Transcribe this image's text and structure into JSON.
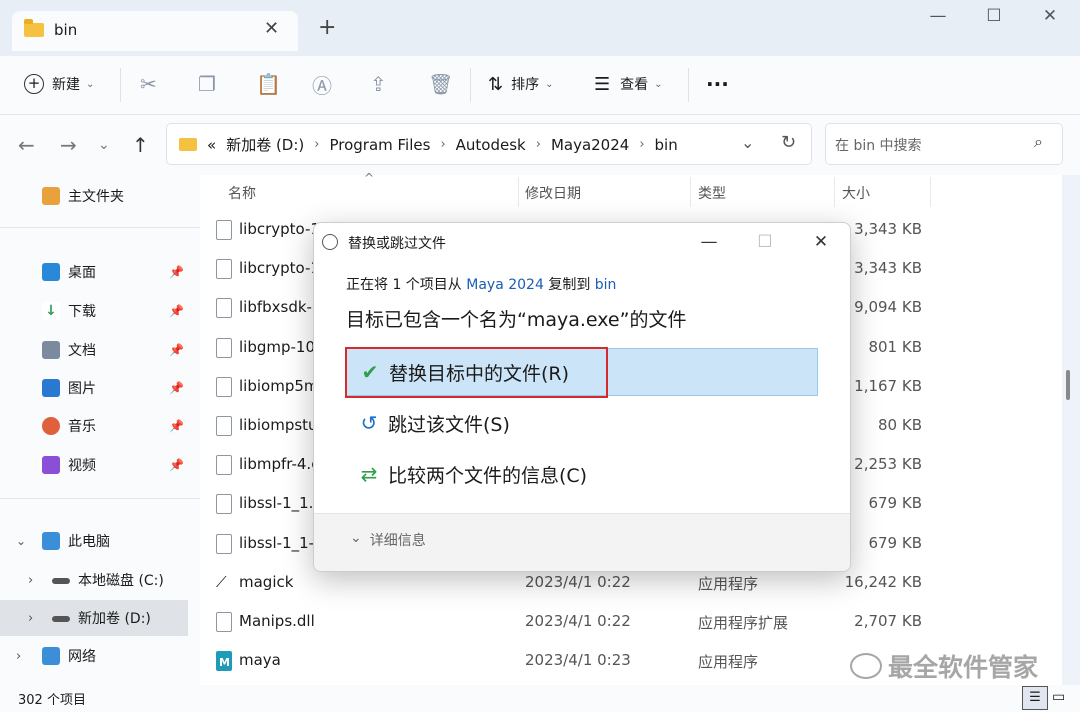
{
  "window": {
    "tab_title": "bin",
    "new_tab": "+",
    "minimize": "—",
    "maximize": "☐",
    "close": "✕"
  },
  "toolbar": {
    "new_label": "新建",
    "sort_label": "排序",
    "view_label": "查看",
    "more_label": "···"
  },
  "address": {
    "prefix": "«",
    "crumbs": [
      "新加卷 (D:)",
      "Program Files",
      "Autodesk",
      "Maya2024",
      "bin"
    ],
    "search_placeholder": "在 bin 中搜索"
  },
  "sidebar": {
    "items": [
      {
        "label": "主文件夹",
        "icon": "home-icon",
        "color": "#e9a23b"
      },
      {
        "label": "桌面",
        "icon": "desktop-icon",
        "color": "#2b88d8"
      },
      {
        "label": "下载",
        "icon": "download-icon",
        "color": "#2f9e58"
      },
      {
        "label": "文档",
        "icon": "document-icon",
        "color": "#7c8a9d"
      },
      {
        "label": "图片",
        "icon": "pictures-icon",
        "color": "#2a79d1"
      },
      {
        "label": "音乐",
        "icon": "music-icon",
        "color": "#e0603e"
      },
      {
        "label": "视频",
        "icon": "video-icon",
        "color": "#8a4fd6"
      },
      {
        "label": "此电脑",
        "icon": "pc-icon",
        "color": "#3b8fd9"
      },
      {
        "label": "本地磁盘 (C:)",
        "icon": "drive-icon",
        "color": "#555555"
      },
      {
        "label": "新加卷 (D:)",
        "icon": "drive-icon",
        "color": "#555555"
      },
      {
        "label": "网络",
        "icon": "network-icon",
        "color": "#3b8fd9"
      }
    ]
  },
  "columns": {
    "name": "名称",
    "date": "修改日期",
    "type": "类型",
    "size": "大小"
  },
  "files": [
    {
      "name": "libcrypto-1",
      "date": "",
      "type": "",
      "size": "3,343 KB"
    },
    {
      "name": "libcrypto-1",
      "date": "",
      "type": "",
      "size": "3,343 KB"
    },
    {
      "name": "libfbxsdk-a",
      "date": "",
      "type": "",
      "size": "9,094 KB"
    },
    {
      "name": "libgmp-10",
      "date": "",
      "type": "",
      "size": "801 KB"
    },
    {
      "name": "libiomp5m",
      "date": "",
      "type": "",
      "size": "1,167 KB"
    },
    {
      "name": "libiompstu",
      "date": "",
      "type": "",
      "size": "80 KB"
    },
    {
      "name": "libmpfr-4.c",
      "date": "",
      "type": "",
      "size": "2,253 KB"
    },
    {
      "name": "libssl-1_1.c",
      "date": "",
      "type": "",
      "size": "679 KB"
    },
    {
      "name": "libssl-1_1-x",
      "date": "",
      "type": "",
      "size": "679 KB"
    },
    {
      "name": "magick",
      "date": "2023/4/1 0:22",
      "type": "应用程序",
      "size": "16,242 KB"
    },
    {
      "name": "Manips.dll",
      "date": "2023/4/1 0:22",
      "type": "应用程序扩展",
      "size": "2,707 KB"
    },
    {
      "name": "maya",
      "date": "2023/4/1 0:23",
      "type": "应用程序",
      "size": ""
    }
  ],
  "status": {
    "count": "302 个项目"
  },
  "dialog": {
    "title": "替换或跳过文件",
    "progress_prefix": "正在将 1 个项目从 ",
    "source": "Maya 2024",
    "progress_mid": " 复制到 ",
    "destination": "bin",
    "headline": "目标已包含一个名为“maya.exe”的文件",
    "options": [
      {
        "label": "替换目标中的文件(R)",
        "icon": "checkmark-icon",
        "color": "#2e9e4a"
      },
      {
        "label": "跳过该文件(S)",
        "icon": "undo-icon",
        "color": "#1a72c9"
      },
      {
        "label": "比较两个文件的信息(C)",
        "icon": "compare-icon",
        "color": "#2e9e4a"
      }
    ],
    "details": "详细信息"
  },
  "watermark": "最全软件管家"
}
